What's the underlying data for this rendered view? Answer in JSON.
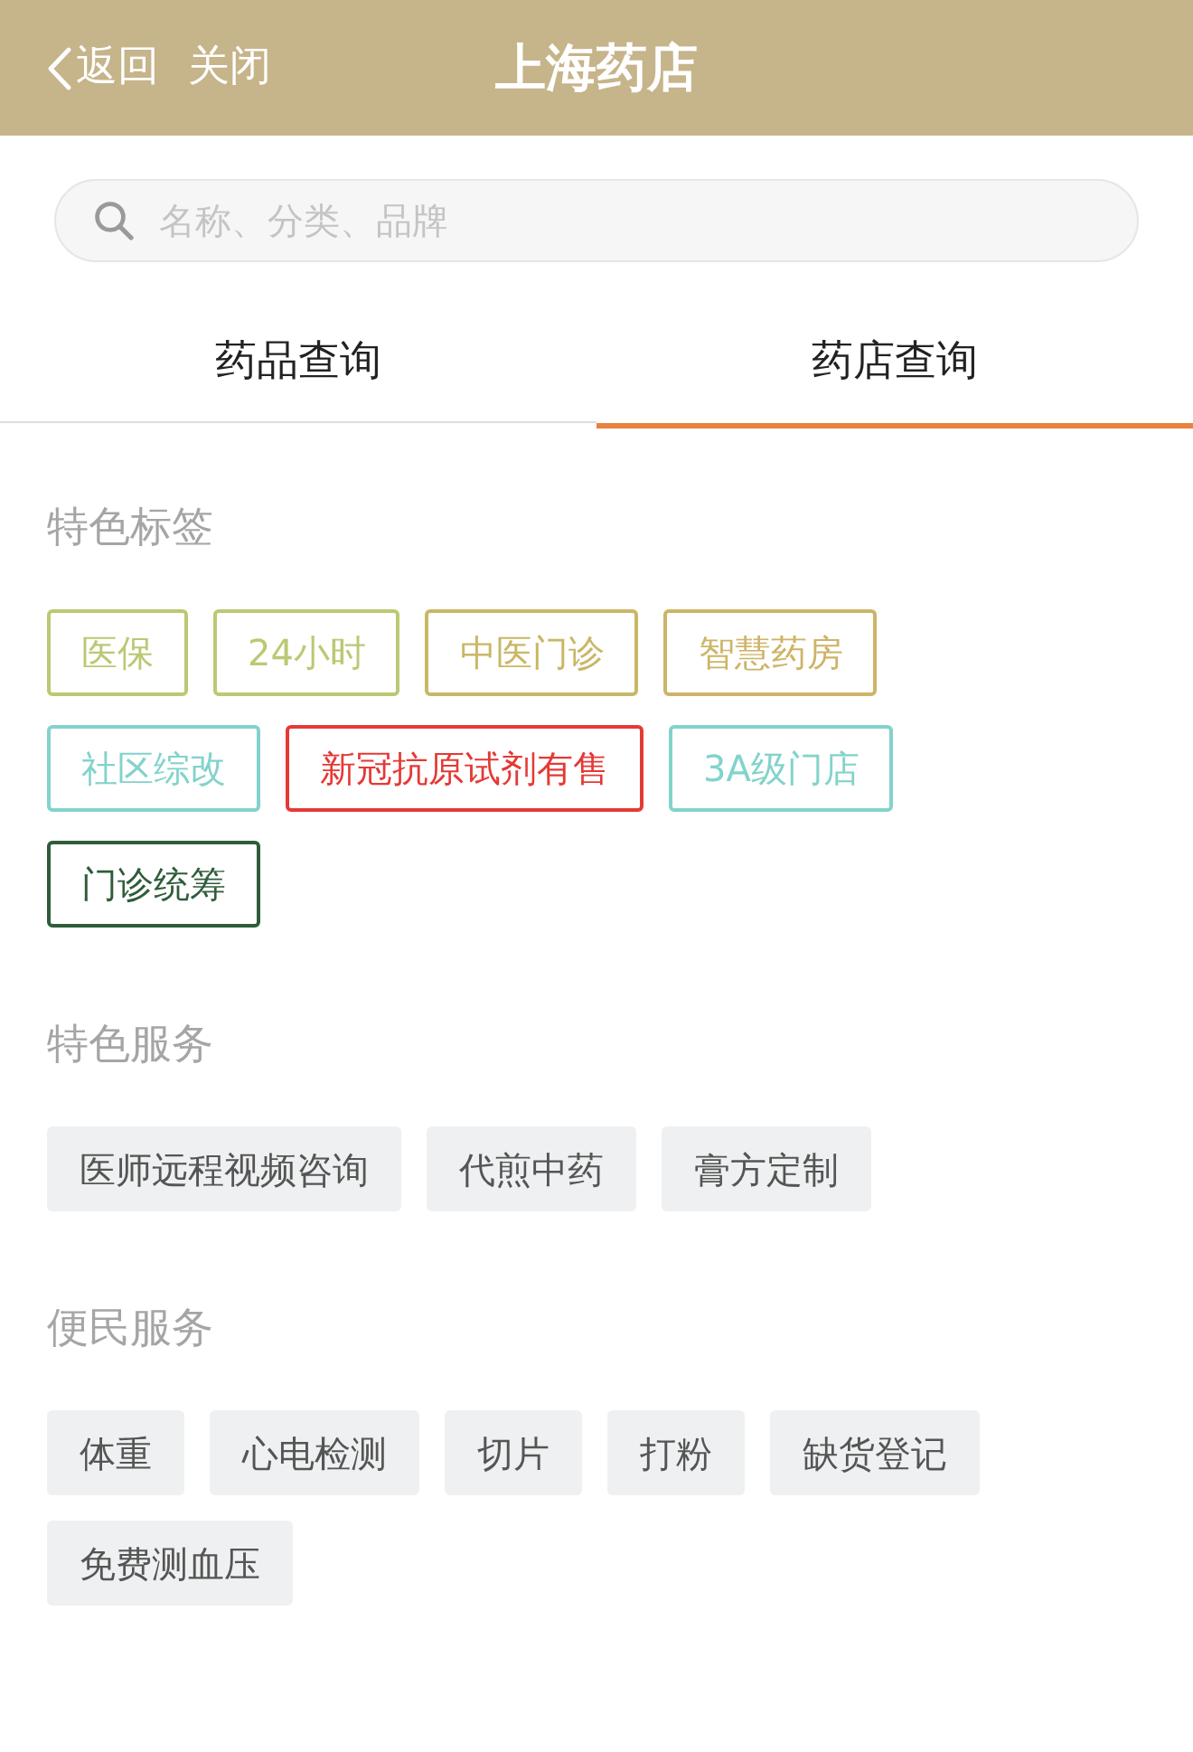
{
  "header": {
    "back": "返回",
    "close": "关闭",
    "title": "上海药店"
  },
  "search": {
    "placeholder": "名称、分类、品牌"
  },
  "tabs": [
    {
      "label": "药品查询",
      "selected": false
    },
    {
      "label": "药店查询",
      "selected": true
    }
  ],
  "sections": [
    {
      "title": "特色标签",
      "kind": "outlined",
      "tags": [
        {
          "label": "医保",
          "color": "#bcc873"
        },
        {
          "label": "24小时",
          "color": "#bcc873"
        },
        {
          "label": "中医门诊",
          "color": "#c9b765"
        },
        {
          "label": "智慧药房",
          "color": "#cdb466"
        },
        {
          "label": "社区综改",
          "color": "#82d3cb"
        },
        {
          "label": "新冠抗原试剂有售",
          "color": "#e53935"
        },
        {
          "label": "3A级门店",
          "color": "#82d3cb"
        },
        {
          "label": "门诊统筹",
          "color": "#2f5d3a"
        }
      ]
    },
    {
      "title": "特色服务",
      "kind": "filled",
      "tags": [
        {
          "label": "医师远程视频咨询"
        },
        {
          "label": "代煎中药"
        },
        {
          "label": "膏方定制"
        }
      ]
    },
    {
      "title": "便民服务",
      "kind": "filled",
      "tags": [
        {
          "label": "体重"
        },
        {
          "label": "心电检测"
        },
        {
          "label": "切片"
        },
        {
          "label": "打粉"
        },
        {
          "label": "缺货登记"
        },
        {
          "label": "免费测血压"
        }
      ]
    }
  ]
}
